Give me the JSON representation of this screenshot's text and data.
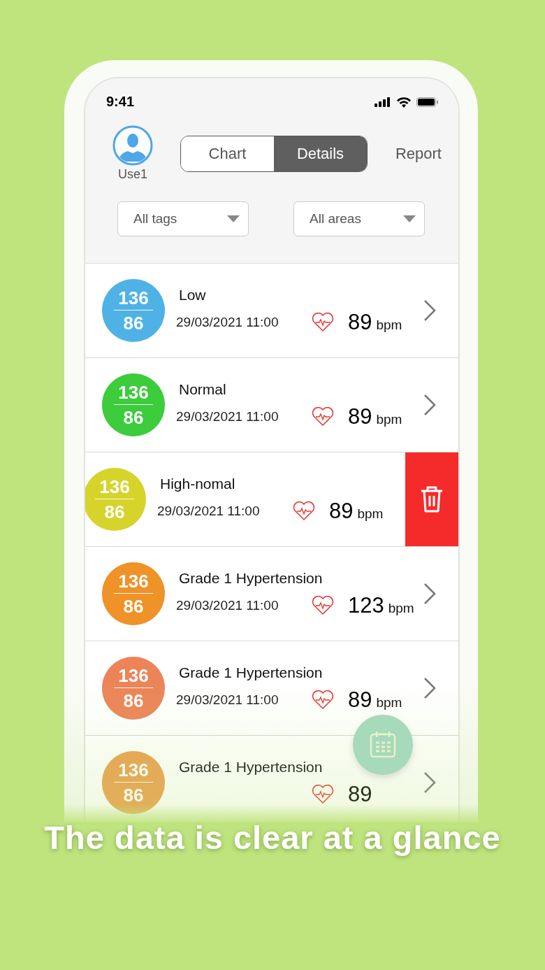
{
  "status_bar": {
    "time": "9:41"
  },
  "header": {
    "user": {
      "name": "Use1"
    },
    "tabs": [
      {
        "label": "Chart",
        "selected": false
      },
      {
        "label": "Details",
        "selected": true
      }
    ],
    "report": "Report"
  },
  "filters": [
    {
      "label": "All tags"
    },
    {
      "label": "All areas"
    }
  ],
  "records": [
    {
      "kind": "normal",
      "systolic": "136",
      "diastolic": "86",
      "color": "#4fb2e6",
      "status": "Low",
      "datetime": "29/03/2021 11:00",
      "pulse": "89",
      "unit": "bpm"
    },
    {
      "kind": "normal",
      "systolic": "136",
      "diastolic": "86",
      "color": "#3ccc3c",
      "status": "Normal",
      "datetime": "29/03/2021 11:00",
      "pulse": "89",
      "unit": "bpm"
    },
    {
      "kind": "swiped",
      "systolic": "136",
      "diastolic": "86",
      "color": "#d6d42a",
      "status": "High-nomal",
      "datetime": "29/03/2021 11:00",
      "pulse": "89",
      "unit": "bpm"
    },
    {
      "kind": "normal",
      "systolic": "136",
      "diastolic": "86",
      "color": "#ef9228",
      "status": "Grade 1 Hypertension",
      "datetime": "29/03/2021 11:00",
      "pulse": "123",
      "unit": "bpm"
    },
    {
      "kind": "normal",
      "systolic": "136",
      "diastolic": "86",
      "color": "#ec8458",
      "status": "Grade 1 Hypertension",
      "datetime": "29/03/2021 11:00",
      "pulse": "89",
      "unit": "bpm"
    },
    {
      "kind": "normal",
      "systolic": "136",
      "diastolic": "86",
      "color": "#eba050",
      "status": "Grade 1 Hypertension",
      "pulse": "89"
    }
  ],
  "caption": "The data is clear at a glance"
}
